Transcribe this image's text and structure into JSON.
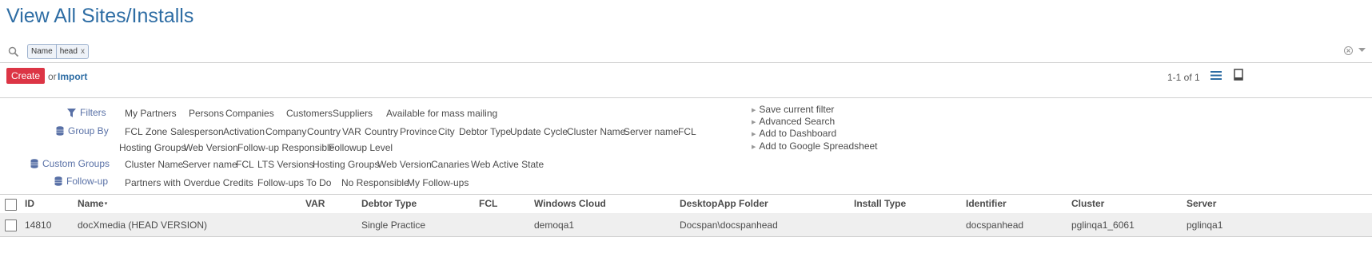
{
  "page": {
    "title": "View All Sites/Installs"
  },
  "search": {
    "facet_category": "Name",
    "facet_value": "head",
    "facet_remove": "x"
  },
  "toolbar": {
    "create_label": "Create",
    "or_label": "or",
    "import_label": "Import",
    "pager": "1-1 of 1"
  },
  "filters": {
    "filters_label": "Filters",
    "filters_items": [
      "My Partners",
      "Persons",
      "Companies",
      "Customers",
      "Suppliers",
      "Available for mass mailing"
    ],
    "groupby_label": "Group By",
    "groupby_items": [
      "FCL",
      "Zone",
      "Salesperson",
      "Activation",
      "Company",
      "Country",
      "VAR",
      "Country",
      "Province",
      "City",
      "Debtor Type",
      "Update Cycle",
      "Cluster Name",
      "Server name",
      "FCL",
      "Hosting Groups",
      "Web Version",
      "Follow-up Responsible",
      "Followup Level"
    ],
    "custom_label": "Custom Groups",
    "custom_items": [
      "Cluster Name",
      "Server name",
      "FCL",
      "LTS Versions",
      "Hosting Groups",
      "Web Version",
      "Canaries",
      "Web Active State"
    ],
    "followup_label": "Follow-up",
    "followup_items": [
      "Partners with Overdue Credits",
      "Follow-ups To Do",
      "No Responsible",
      "My Follow-ups"
    ],
    "right_items": [
      "Save current filter",
      "Advanced Search",
      "Add to Dashboard",
      "Add to Google Spreadsheet"
    ]
  },
  "table": {
    "columns": [
      "ID",
      "Name",
      "VAR",
      "Debtor Type",
      "FCL",
      "Windows Cloud",
      "DesktopApp Folder",
      "Install Type",
      "Identifier",
      "Cluster",
      "Server"
    ],
    "sort_indicator": "▾",
    "rows": [
      [
        "14810",
        "docXmedia (HEAD VERSION)",
        "",
        "Single Practice",
        "",
        "demoqa1",
        "Docspan\\docspanhead",
        "",
        "docspanhead",
        "pglinqa1_6061",
        "pglinqa1"
      ]
    ]
  },
  "colors": {
    "title": "#2e6da4",
    "create": "#dc3545",
    "group_label": "#5870a6",
    "link": "#2e6da4"
  },
  "icons": [
    "search-icon",
    "clear-icon",
    "dropdown-icon",
    "list-view-icon",
    "form-view-icon",
    "filter-icon",
    "database-icon"
  ]
}
